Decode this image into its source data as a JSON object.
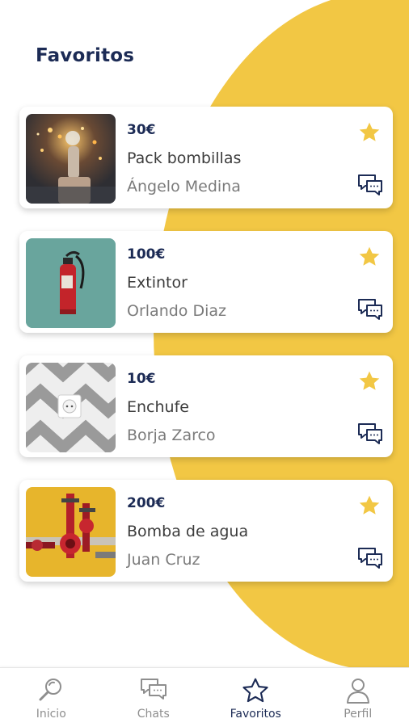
{
  "header": {
    "title": "Favoritos"
  },
  "favorites": [
    {
      "price": "30€",
      "title": "Pack bombillas",
      "seller": "Ángelo Medina",
      "image_icon": "light-bulbs-photo",
      "favorited": true
    },
    {
      "price": "100€",
      "title": "Extintor",
      "seller": "Orlando Diaz",
      "image_icon": "fire-extinguisher-photo",
      "favorited": true
    },
    {
      "price": "10€",
      "title": "Enchufe",
      "seller": "Borja Zarco",
      "image_icon": "wall-socket-photo",
      "favorited": true
    },
    {
      "price": "200€",
      "title": "Bomba de agua",
      "seller": "Juan Cruz",
      "image_icon": "water-pump-photo",
      "favorited": true
    }
  ],
  "tabbar": {
    "items": [
      {
        "label": "Inicio",
        "icon": "search-icon",
        "active": false
      },
      {
        "label": "Chats",
        "icon": "chat-bubbles-icon",
        "active": false
      },
      {
        "label": "Favoritos",
        "icon": "star-icon",
        "active": true
      },
      {
        "label": "Perfil",
        "icon": "person-icon",
        "active": false
      }
    ]
  },
  "colors": {
    "accent_yellow": "#f2c744",
    "navy": "#1c2b55",
    "star": "#f2c744",
    "inactive_tab": "#8e8e8e"
  }
}
